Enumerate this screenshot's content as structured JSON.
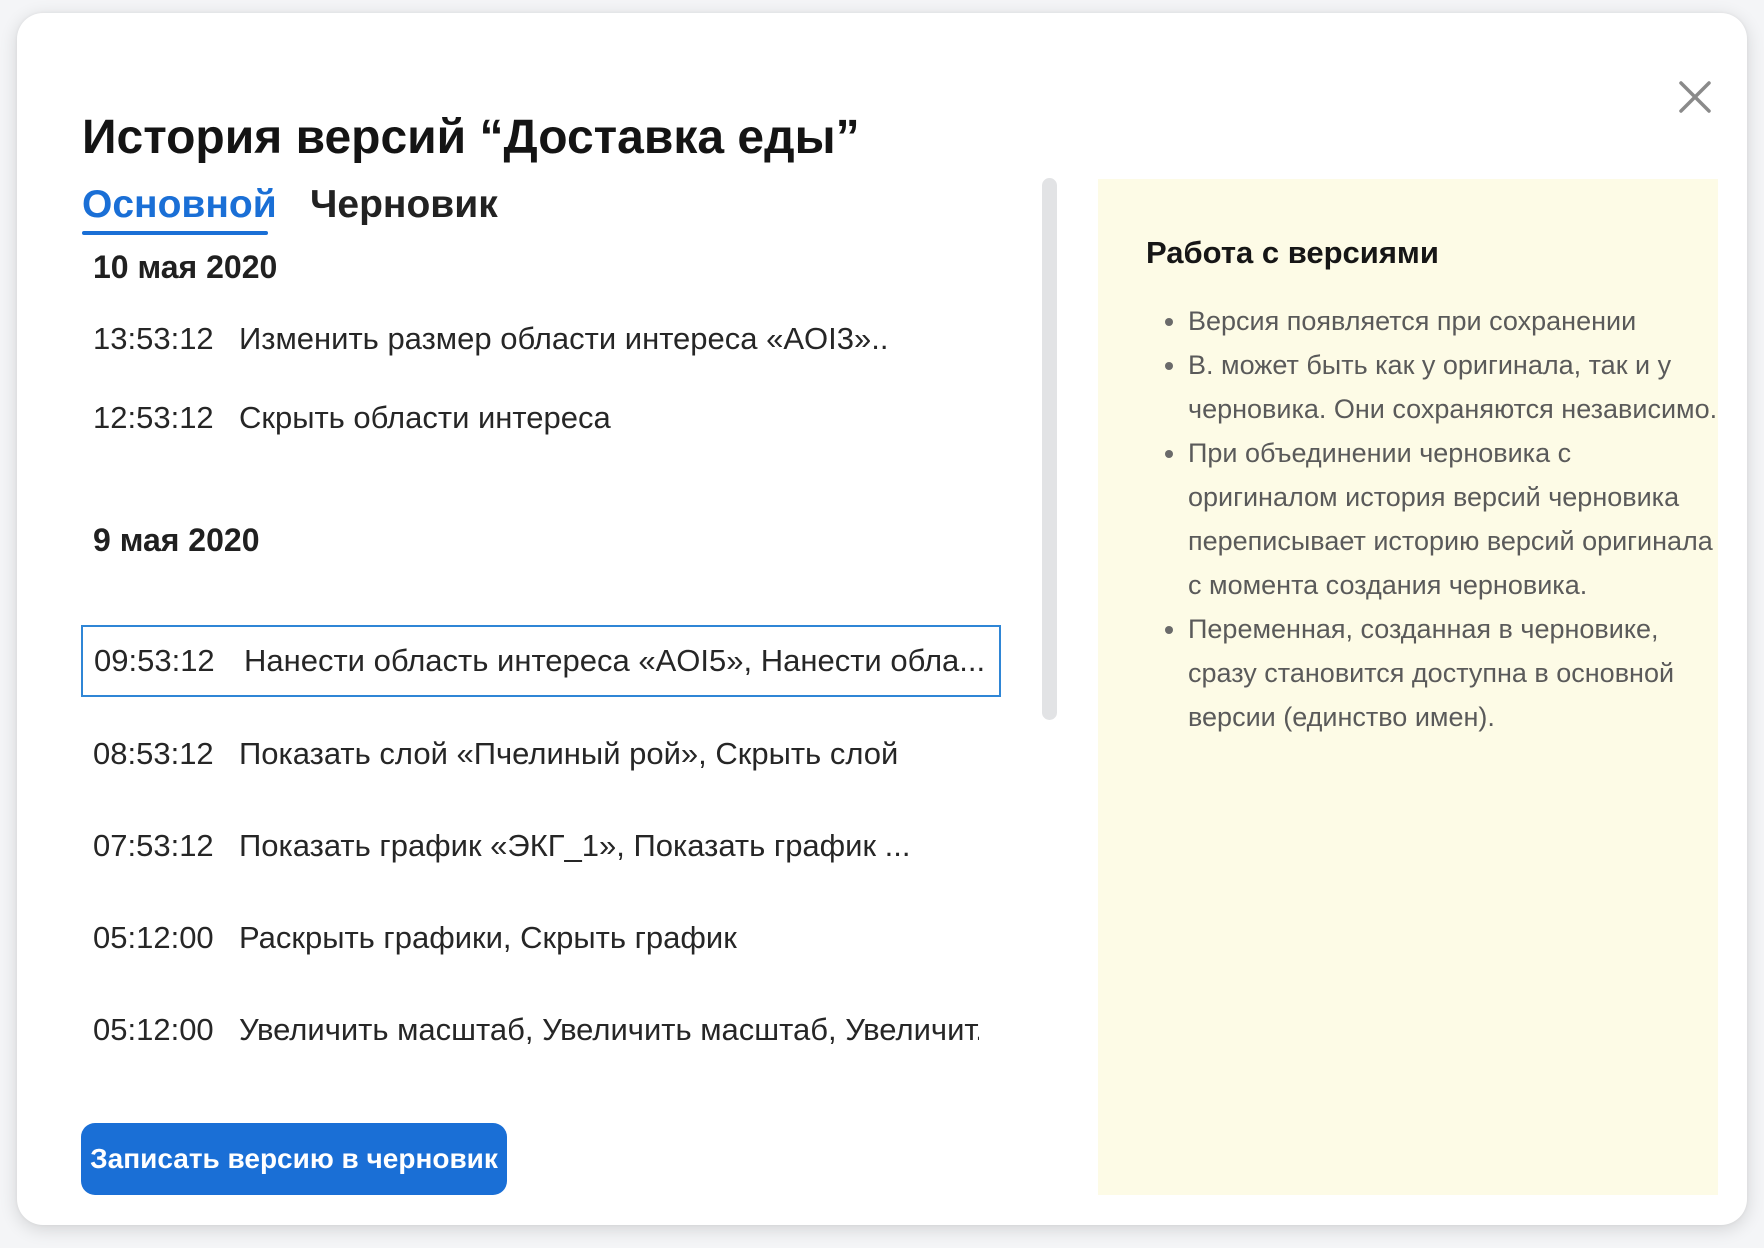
{
  "dialog": {
    "title": "История версий “Доставка еды”",
    "close_icon": "close-icon"
  },
  "tabs": [
    {
      "label": "Основной",
      "active": true
    },
    {
      "label": "Черновик",
      "active": false
    }
  ],
  "history": {
    "groups": [
      {
        "date": "10 мая 2020",
        "items": [
          {
            "time": "13:53:12",
            "action": "Изменить размер области интереса «AOI3».."
          },
          {
            "time": "12:53:12",
            "action": "Скрыть области интереса"
          }
        ]
      },
      {
        "date": "9 мая 2020",
        "items": [
          {
            "time": "09:53:12",
            "action": "Нанести область интереса «AOI5», Нанести обла...",
            "selected": true
          },
          {
            "time": "08:53:12",
            "action": "Показать слой «Пчелиный рой», Скрыть слой"
          },
          {
            "time": "07:53:12",
            "action": "Показать график «ЭКГ_1», Показать график ..."
          },
          {
            "time": "05:12:00",
            "action": "Раскрыть графики, Скрыть график"
          },
          {
            "time": "05:12:00",
            "action": "Увеличить масштаб, Увеличить масштаб, Увеличит..."
          }
        ]
      }
    ]
  },
  "actions": {
    "save_draft_label": "Записать версию в черновик"
  },
  "info": {
    "title": "Работа с версиями",
    "points": [
      "Версия появляется при сохранении",
      "В. может быть как у оригинала, так и у черновика. Они сохраняются независимо.",
      "При объединении черновика с оригиналом история версий черновика переписывает историю версий оригинала с момента создания черновика.",
      "Переменная, созданная в черновике, сразу становится доступна в основной версии (единство имен)."
    ]
  },
  "colors": {
    "accent": "#1a6fd6",
    "selected_border": "#2f86d6",
    "info_background": "#fdfbe6"
  }
}
